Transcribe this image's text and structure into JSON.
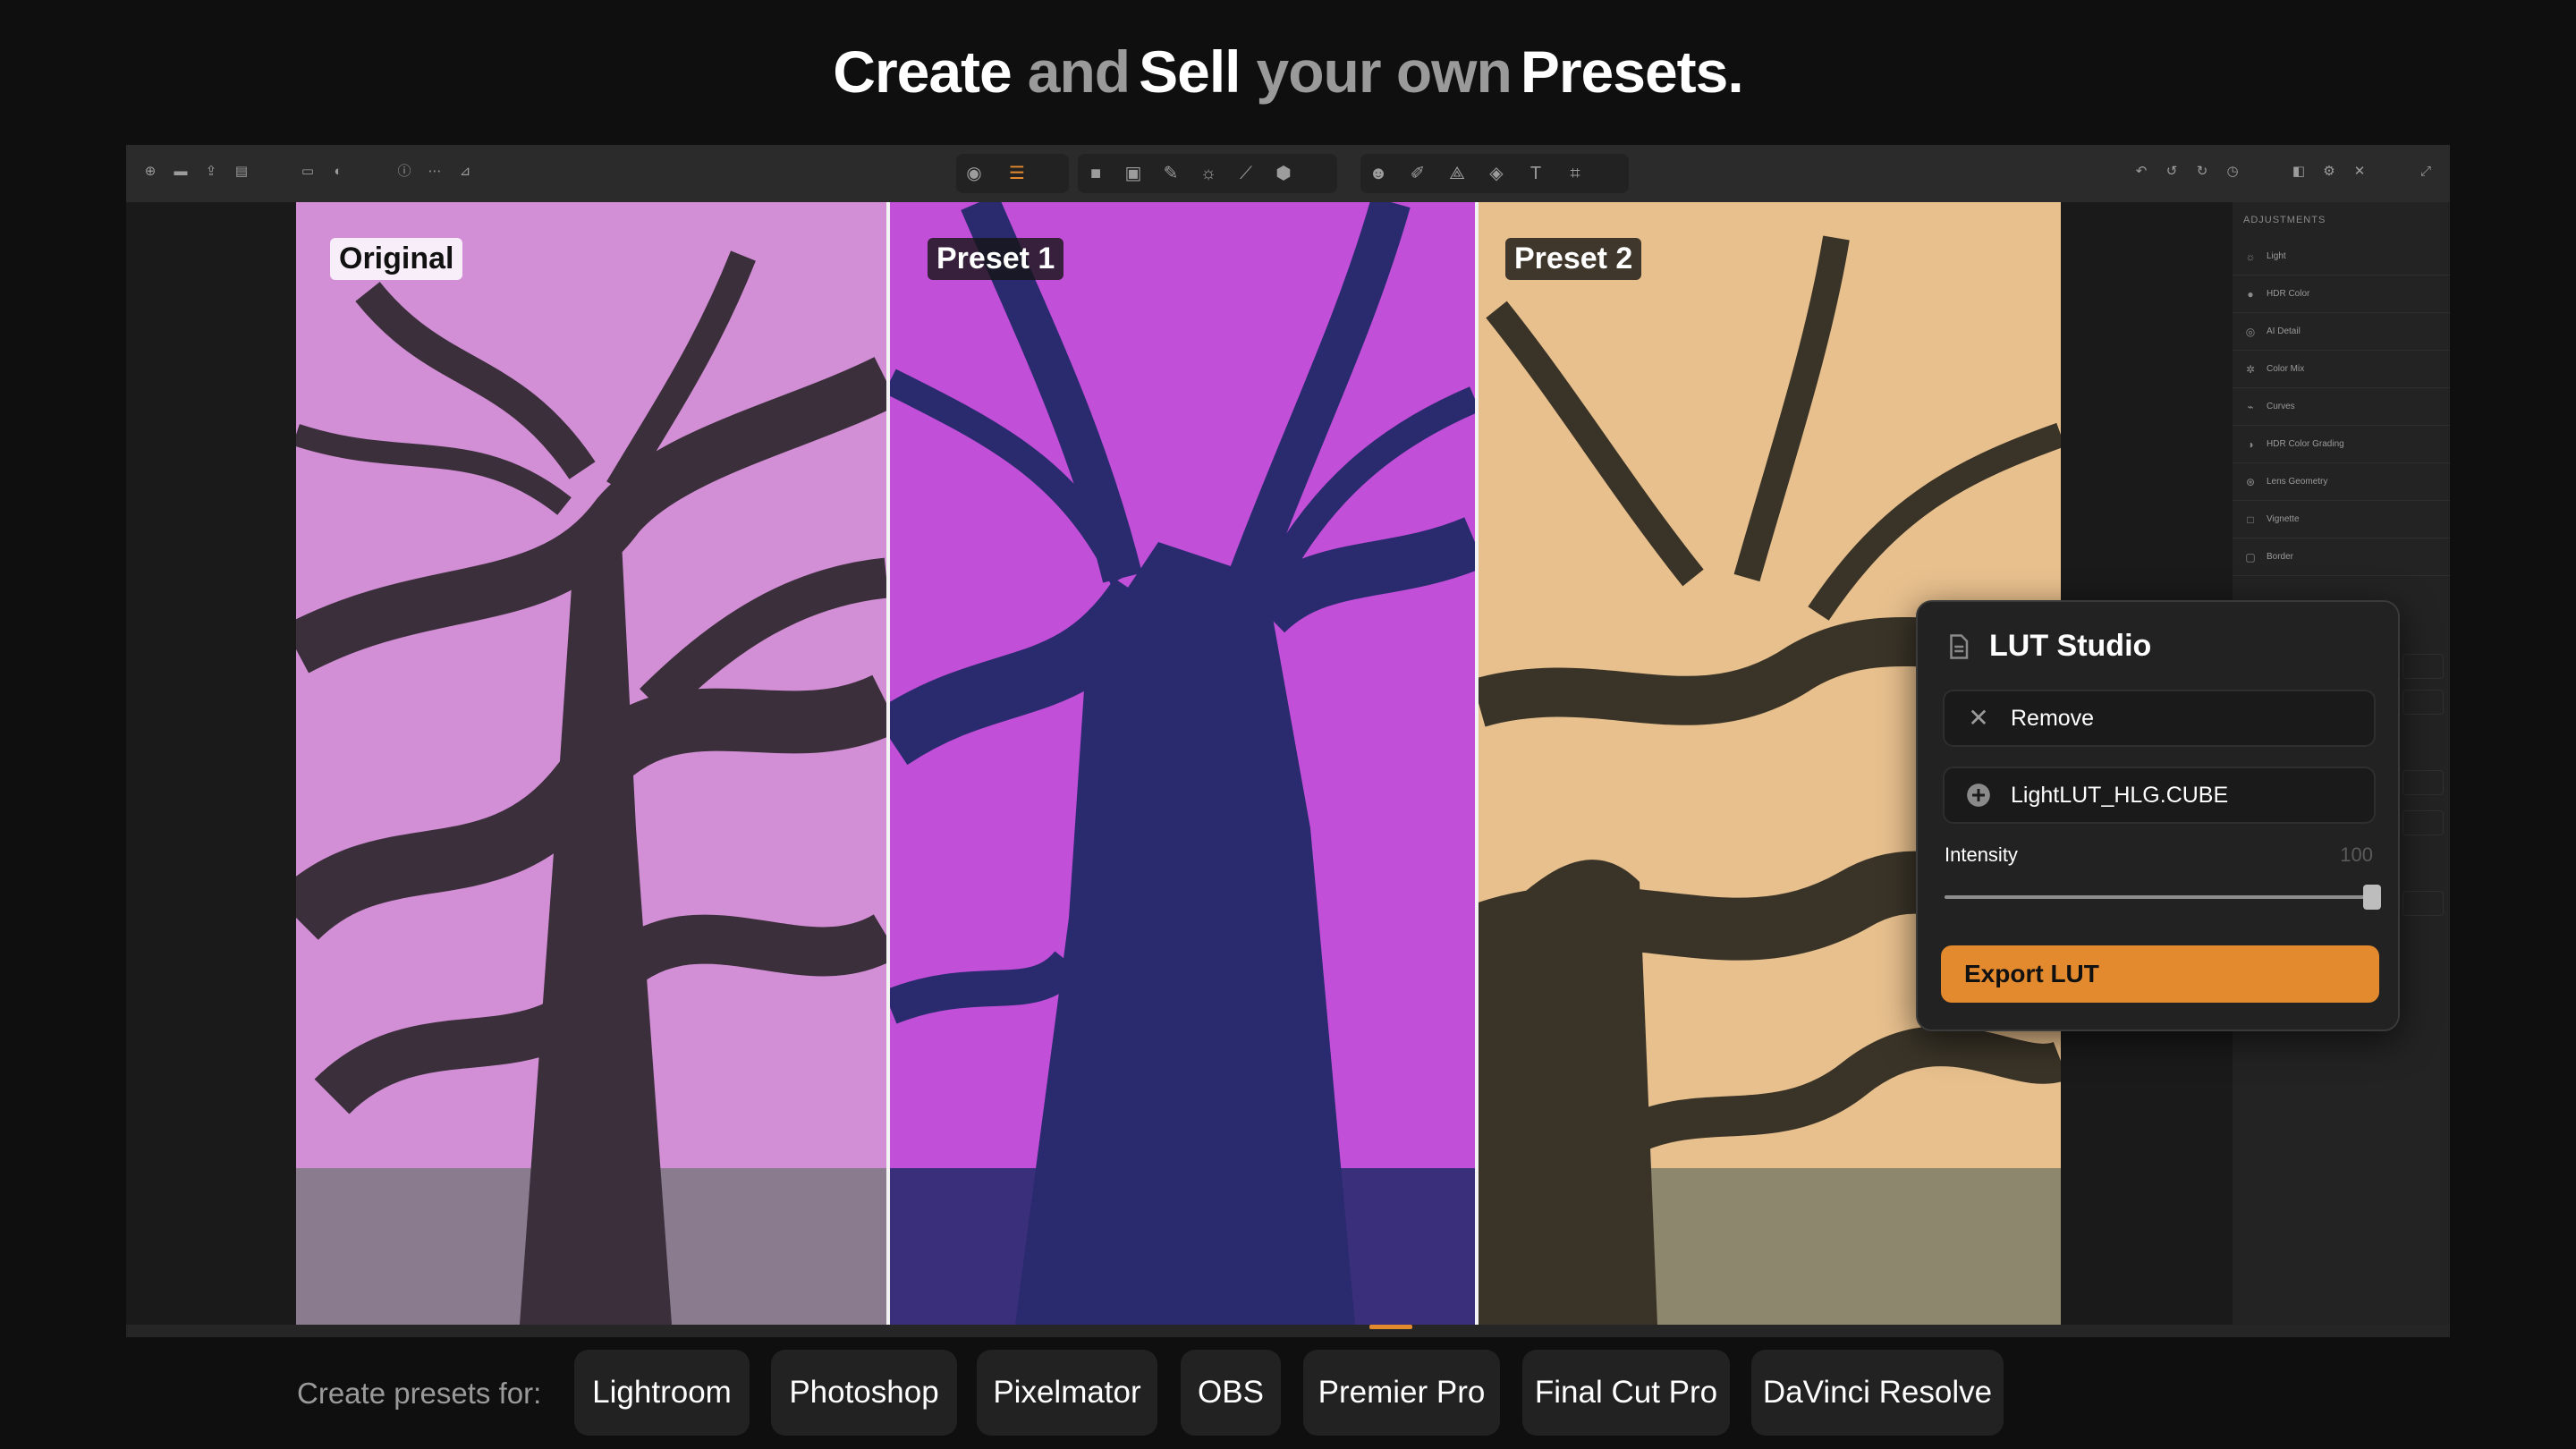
{
  "hero": {
    "w1": "Create",
    "g1": "and",
    "w2": "Sell",
    "g2": "your own",
    "w3": "Presets."
  },
  "toolbar": {
    "left_icons": [
      "add-icon",
      "folder-icon",
      "share-icon",
      "trash-icon",
      "window-icon",
      "edit-icon",
      "info-icon",
      "more-icon",
      "tag-icon"
    ],
    "center_group1": [
      "mask-icon",
      "sliders-icon"
    ],
    "center_group2": [
      "square-icon",
      "landscape-icon",
      "eyedropper-icon",
      "sun-icon",
      "brush-icon",
      "cube-icon"
    ],
    "center_group3": [
      "face-icon",
      "wand-icon",
      "triangle-icon",
      "layers-icon",
      "text-icon",
      "crop-icon"
    ],
    "right_icons": [
      "undo-icon",
      "undo2-icon",
      "redo-icon",
      "history-icon",
      "compare-icon",
      "settings-icon",
      "magic-icon",
      "expand-icon"
    ]
  },
  "images": [
    {
      "label": "Original",
      "style": "light",
      "palette": {
        "sky": "#d28fd6",
        "trunk": "#3b2f3b",
        "ground": "#8a7b8e"
      }
    },
    {
      "label": "Preset 1",
      "style": "dark",
      "palette": {
        "sky": "#c24fd8",
        "trunk": "#2a2a6e",
        "ground": "#3a2f7a"
      }
    },
    {
      "label": "Preset 2",
      "style": "dark",
      "palette": {
        "sky": "#e8c08e",
        "trunk": "#3a3428",
        "ground": "#8d876d"
      }
    }
  ],
  "sidebar": {
    "title": "ADJUSTMENTS",
    "items": [
      {
        "label": "Light",
        "icon": "sun-icon"
      },
      {
        "label": "HDR Color",
        "icon": "drop-icon"
      },
      {
        "label": "AI Detail",
        "icon": "detail-icon"
      },
      {
        "label": "Color Mix",
        "icon": "colormix-icon"
      },
      {
        "label": "Curves",
        "icon": "curves-icon"
      },
      {
        "label": "HDR Color Grading",
        "icon": "grading-icon"
      },
      {
        "label": "Lens Geometry",
        "icon": "lens-icon"
      },
      {
        "label": "Vignette",
        "icon": "vignette-icon"
      },
      {
        "label": "Border",
        "icon": "border-icon"
      }
    ]
  },
  "lut": {
    "title": "LUT Studio",
    "remove_label": "Remove",
    "file_label": "LightLUT_HLG.CUBE",
    "intensity_label": "Intensity",
    "intensity_value": "100",
    "intensity_fraction": 1.0,
    "export_label": "Export LUT",
    "accent": "#e38a2e"
  },
  "presets": {
    "label": "Create presets for:",
    "apps": [
      "Lightroom",
      "Photoshop",
      "Pixelmator",
      "OBS",
      "Premier Pro",
      "Final Cut Pro",
      "DaVinci Resolve"
    ]
  }
}
